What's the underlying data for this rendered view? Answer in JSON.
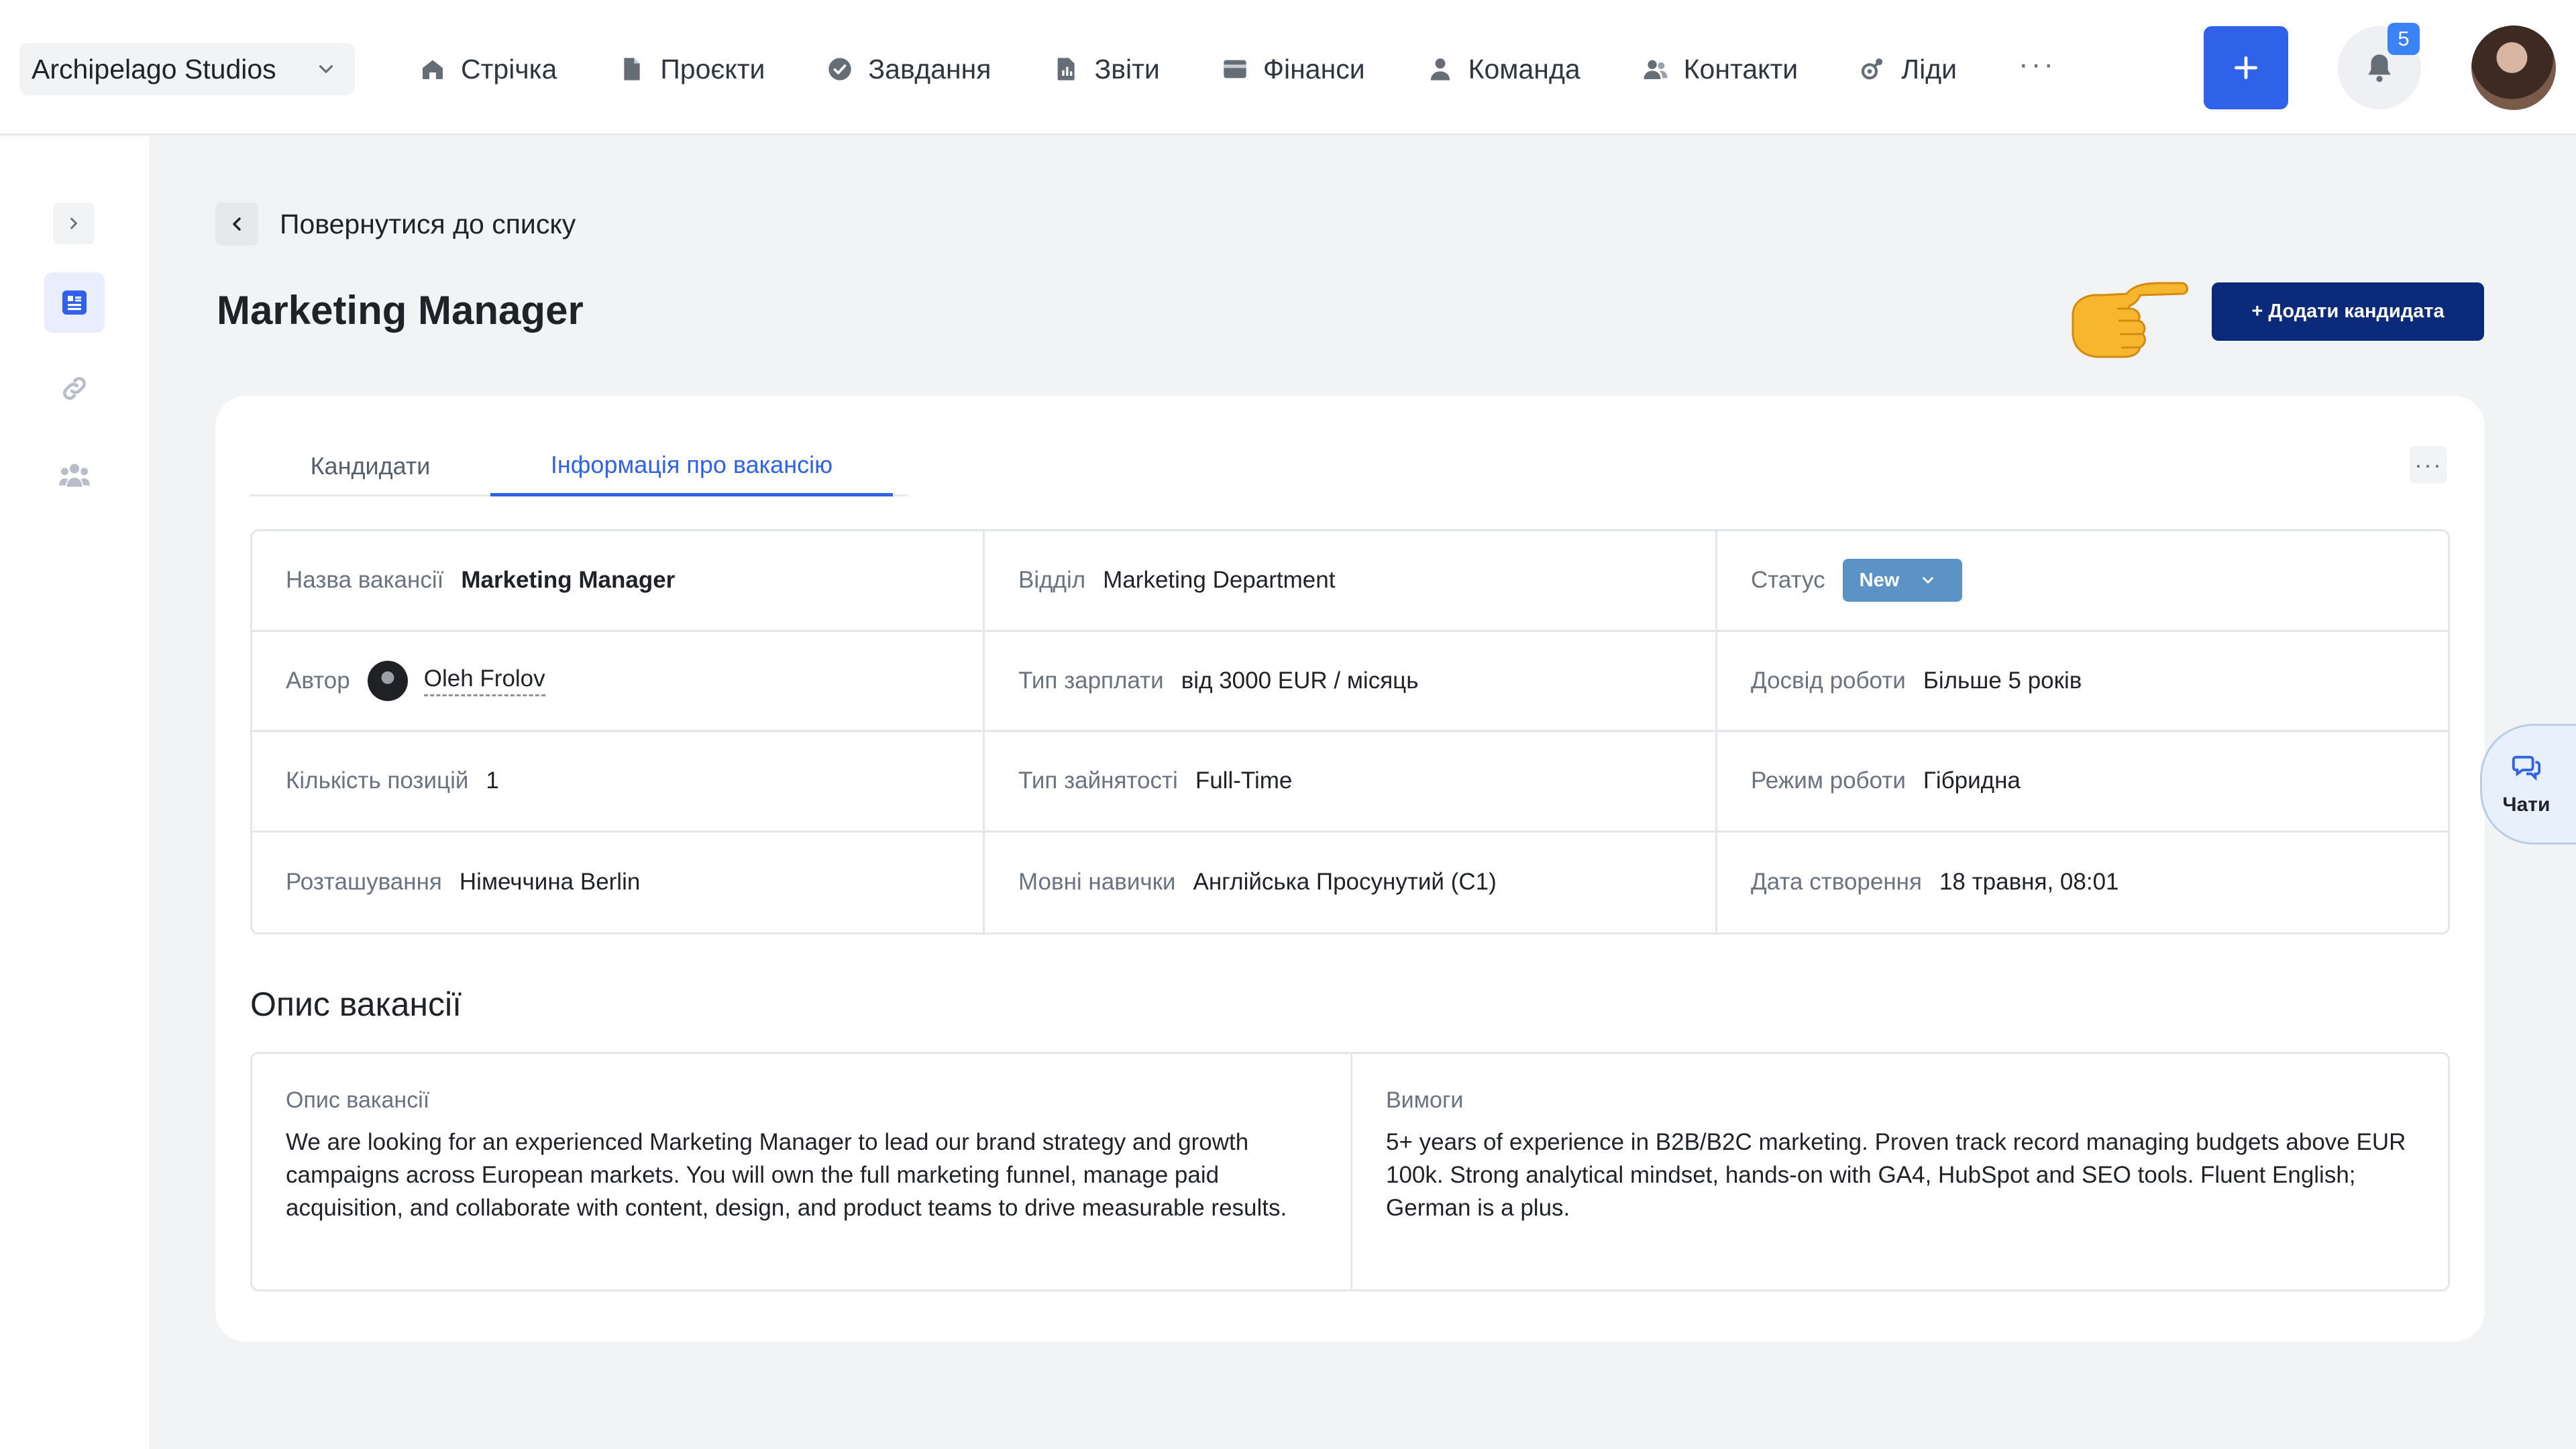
{
  "header": {
    "company": "Archipelago Studios",
    "nav": [
      {
        "label": "Стрічка",
        "icon": "home-icon"
      },
      {
        "label": "Проєкти",
        "icon": "file-icon"
      },
      {
        "label": "Завдання",
        "icon": "check-circle-icon"
      },
      {
        "label": "Звіти",
        "icon": "report-icon"
      },
      {
        "label": "Фінанси",
        "icon": "wallet-icon"
      },
      {
        "label": "Команда",
        "icon": "user-icon"
      },
      {
        "label": "Контакти",
        "icon": "contacts-icon"
      },
      {
        "label": "Ліди",
        "icon": "leads-icon"
      }
    ],
    "more": "···",
    "notifications_count": "5",
    "accent": "#2f62e8"
  },
  "page": {
    "back_label": "Повернутися до списку",
    "title": "Marketing Manager",
    "add_candidate_label": "+ Додати кандидата"
  },
  "tabs": [
    {
      "label": "Кандидати",
      "active": false
    },
    {
      "label": "Інформація про вакансію",
      "active": true
    }
  ],
  "info": {
    "vacancy_name": {
      "label": "Назва вакансії",
      "value": "Marketing Manager"
    },
    "department": {
      "label": "Відділ",
      "value": "Marketing Department"
    },
    "status": {
      "label": "Статус",
      "value": "New"
    },
    "author": {
      "label": "Автор",
      "value": "Oleh Frolov"
    },
    "salary_type": {
      "label": "Тип зарплати",
      "value": "від 3000 EUR / місяць"
    },
    "experience": {
      "label": "Досвід роботи",
      "value": "Більше 5 років"
    },
    "positions": {
      "label": "Кількість позицій",
      "value": "1"
    },
    "employment": {
      "label": "Тип зайнятості",
      "value": "Full-Time"
    },
    "work_mode": {
      "label": "Режим роботи",
      "value": "Гібридна"
    },
    "location": {
      "label": "Розташування",
      "value": "Німеччина Berlin"
    },
    "languages": {
      "label": "Мовні навички",
      "value": "Англійська Просунутий (C1)"
    },
    "created": {
      "label": "Дата створення",
      "value": "18 травня, 08:01"
    }
  },
  "description": {
    "section_title": "Опис вакансії",
    "desc_label": "Опис вакансії",
    "desc_text": "We are looking for an experienced Marketing Manager to lead our brand strategy and growth campaigns across European markets. You will own the full marketing funnel, manage paid acquisition, and collaborate with content, design, and product teams to drive measurable results.",
    "req_label": "Вимоги",
    "req_text": "5+ years of experience in B2B/B2C marketing. Proven track record managing budgets above EUR 100k. Strong analytical mindset, hands-on with GA4, HubSpot and SEO tools. Fluent English; German is a plus."
  },
  "chat": {
    "label": "Чати"
  }
}
